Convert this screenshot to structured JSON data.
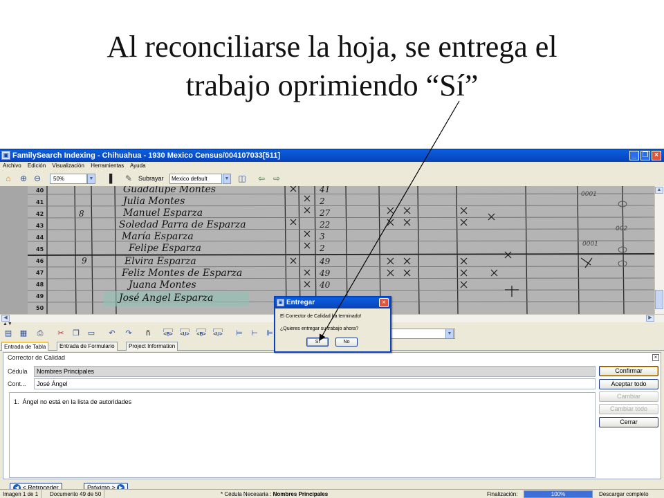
{
  "slide": {
    "title_line1": "Al reconciliarse la hoja, se entrega el",
    "title_line2": "trabajo oprimiendo “Sí”"
  },
  "window": {
    "title": "FamilySearch Indexing - Chihuahua - 1930 Mexico Census/004107033[511]",
    "minimize_label": "_",
    "restore_label": "❐",
    "close_label": "×"
  },
  "menu": [
    "Archivo",
    "Edición",
    "Visualización",
    "Herramientas",
    "Ayuda"
  ],
  "toolbar": {
    "zoom_value": "50%",
    "highlight_label": "Subrayar",
    "highlight_value": "Mexico default"
  },
  "image": {
    "row_numbers": [
      "40",
      "41",
      "42",
      "43",
      "44",
      "45",
      "46",
      "47",
      "48",
      "49",
      "50"
    ],
    "handwritten_names": [
      "Guadalupe Montes",
      "Julia Montes",
      "Manuel Esparza",
      "Soledad Parra de Esparza",
      "María Esparza",
      "Felipe Esparza",
      "Elvira Esparza",
      "Feliz Montes de Esparza",
      "Juana Montes",
      "José Angel Esparza"
    ]
  },
  "format_buttons": [
    "<B>",
    "<U>",
    "<B>",
    "<U>"
  ],
  "tabs": [
    {
      "label": "Entrada de Tabla",
      "active": true
    },
    {
      "label": "Entrada de Formulario",
      "active": false
    },
    {
      "label": "Project Information",
      "active": false
    }
  ],
  "quality_checker": {
    "title": "Corrector de Calidad",
    "close_label": "×",
    "cell_label": "Cédula",
    "cell_value": "Nombres Principales",
    "content_label": "Cont...",
    "content_value": "José Ángel",
    "issues": [
      "Ángel no está en la lista de autoridades"
    ],
    "buttons": [
      {
        "label": "Confirmar",
        "enabled": true
      },
      {
        "label": "Aceptar todo",
        "enabled": true
      },
      {
        "label": "Cambiar",
        "enabled": false
      },
      {
        "label": "Cambiar todo",
        "enabled": false
      },
      {
        "label": "Cerrar",
        "enabled": true
      }
    ]
  },
  "navigation": {
    "back_label": "Retroceder",
    "next_label": "Próximo >"
  },
  "status": {
    "image": "Imagen 1 de 1",
    "document": "Documento 49 de 50",
    "required_prefix": "* Cédula Necesaria : ",
    "required_value": "Nombres Principales",
    "completion_label": "Finalización:",
    "progress_percent": 100,
    "progress_text": "100%",
    "download_status": "Descargar completo"
  },
  "dialog": {
    "title": "Entregar",
    "close_label": "×",
    "line1": "El Corrector de Calidad ha terminado!",
    "line2": "¿Quieres entregar su trabajo ahora?",
    "yes_label": "Sí",
    "no_label": "No"
  },
  "colors": {
    "titlebar": "#0842b8",
    "progress": "#3d6fd6",
    "ink": "#1a1a1a"
  }
}
